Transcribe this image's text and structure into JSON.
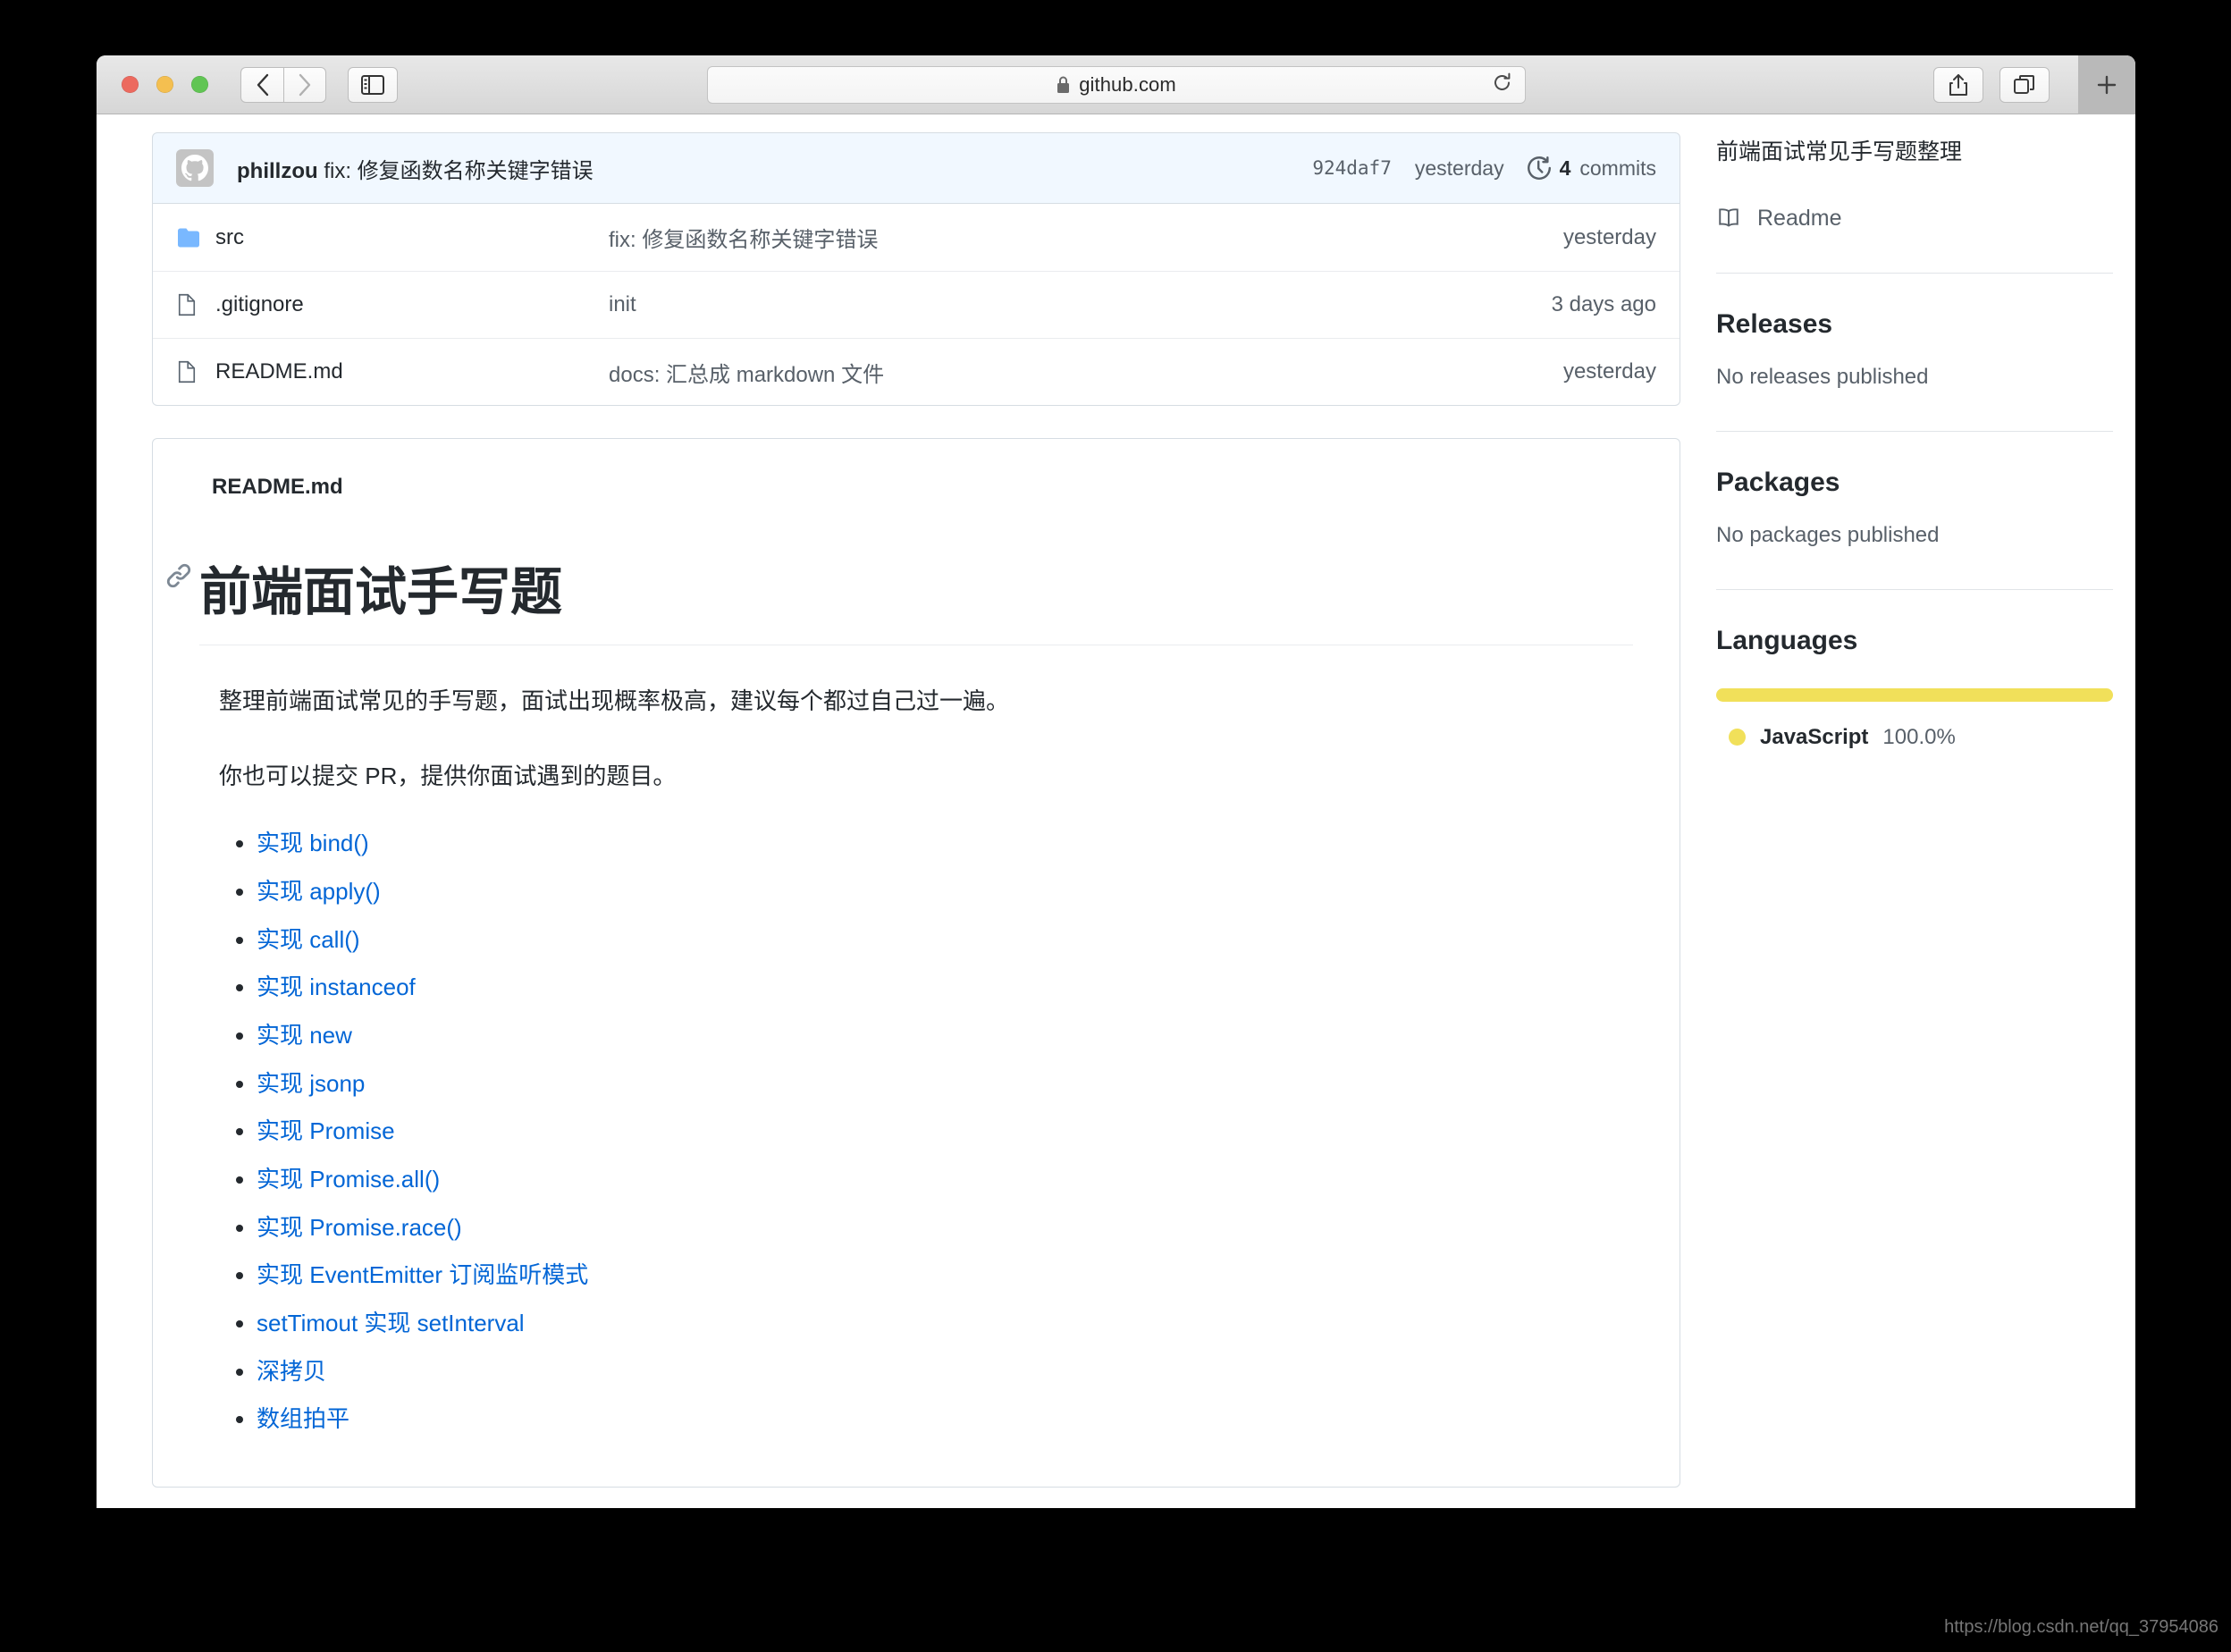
{
  "browser": {
    "url_text": "github.com",
    "lock_icon": "lock-icon",
    "reload_icon": "reload-icon",
    "back_icon": "chevron-left-icon",
    "forward_icon": "chevron-right-icon",
    "sidebar_icon": "sidebar-toggle-icon",
    "share_icon": "share-icon",
    "tabs_icon": "tab-overview-icon",
    "newtab_icon": "plus-icon"
  },
  "repo": {
    "commit_bar": {
      "author": "phillzou",
      "message": "fix: 修复函数名称关键字错误",
      "sha": "924daf7",
      "age": "yesterday",
      "commits_count": "4",
      "commits_label": "commits",
      "history_icon": "history-icon",
      "avatar_icon": "github-avatar-icon"
    },
    "files": [
      {
        "icon": "folder-icon",
        "type": "folder",
        "name": "src",
        "message": "fix: 修复函数名称关键字错误",
        "age": "yesterday"
      },
      {
        "icon": "file-icon",
        "type": "file",
        "name": ".gitignore",
        "message": "init",
        "age": "3 days ago"
      },
      {
        "icon": "file-icon",
        "type": "file",
        "name": "README.md",
        "message": "docs: 汇总成 markdown 文件",
        "age": "yesterday"
      }
    ]
  },
  "readme": {
    "header": "README.md",
    "title": "前端面试手写题",
    "anchor_icon": "link-icon",
    "paragraphs": [
      "整理前端面试常见的手写题，面试出现概率极高，建议每个都过自己过一遍。",
      "你也可以提交 PR，提供你面试遇到的题目。"
    ],
    "links": [
      "实现 bind()",
      "实现 apply()",
      "实现 call()",
      "实现 instanceof",
      "实现 new",
      "实现 jsonp",
      "实现 Promise",
      "实现 Promise.all()",
      "实现 Promise.race()",
      "实现 EventEmitter 订阅监听模式",
      "setTimout 实现 setInterval",
      "深拷贝",
      "数组拍平"
    ]
  },
  "sidebar": {
    "description": "前端面试常见手写题整理",
    "readme_label": "Readme",
    "readme_icon": "book-icon",
    "releases_title": "Releases",
    "releases_note": "No releases published",
    "packages_title": "Packages",
    "packages_note": "No packages published",
    "languages_title": "Languages",
    "language_name": "JavaScript",
    "language_percent": "100.0%",
    "language_color": "#f1e05a"
  },
  "watermark": "https://blog.csdn.net/qq_37954086"
}
